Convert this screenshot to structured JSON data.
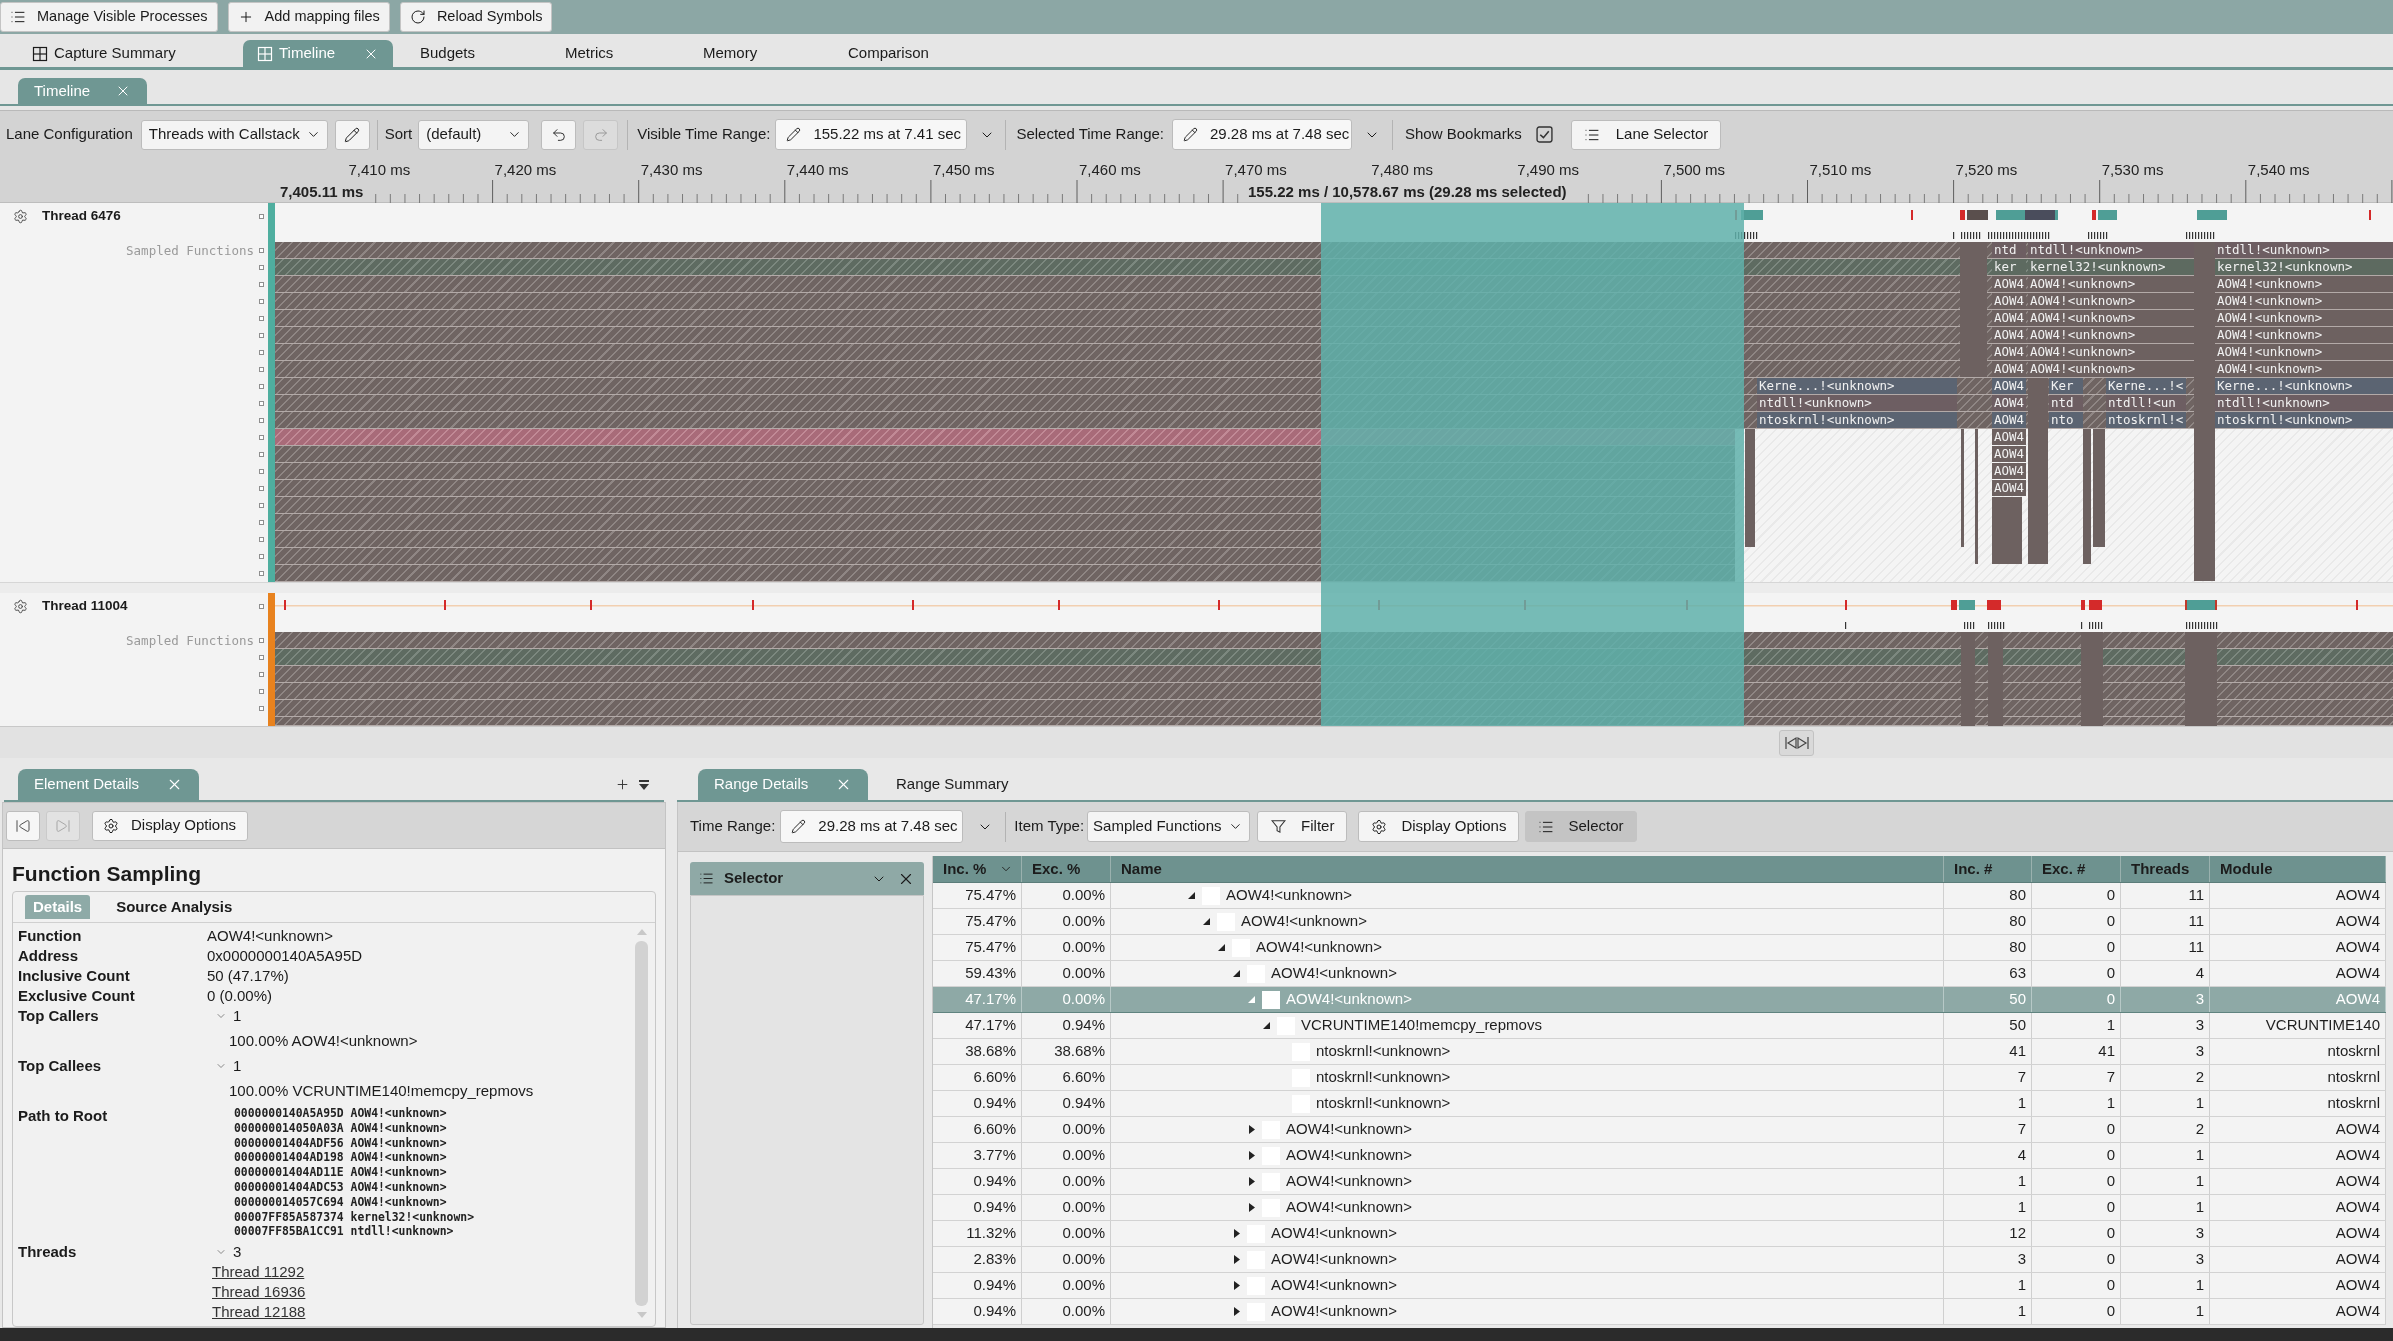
{
  "top_toolbar": {
    "buttons": [
      "Manage Visible Processes",
      "Add mapping files",
      "Reload Symbols"
    ]
  },
  "document_tabs": [
    {
      "label": "Capture Summary",
      "kind": "view",
      "selected": false
    },
    {
      "label": "Timeline",
      "kind": "view",
      "selected": true
    },
    {
      "label": "Budgets",
      "kind": "plain",
      "selected": false
    },
    {
      "label": "Metrics",
      "kind": "plain",
      "selected": false
    },
    {
      "label": "Memory",
      "kind": "plain",
      "selected": false
    },
    {
      "label": "Comparison",
      "kind": "plain",
      "selected": false
    }
  ],
  "view_tabs": [
    {
      "label": "Timeline",
      "selected": true
    }
  ],
  "lane_toolbar": {
    "lane_configuration": {
      "label": "Lane Configuration",
      "value": "Threads with Callstack"
    },
    "sort": {
      "label": "Sort",
      "value": "(default)"
    },
    "history": [
      {
        "kind": "undo",
        "disabled": false
      },
      {
        "kind": "redo",
        "disabled": true
      }
    ],
    "visible_time_range": {
      "label": "Visible Time Range:",
      "value": "155.22 ms at 7.41 sec"
    },
    "selected_time_range": {
      "label": "Selected Time Range:",
      "value": "29.28 ms at 7.48 sec"
    },
    "show_bookmarks": {
      "label": "Show Bookmarks",
      "checked": true
    },
    "lane_selector": {
      "label": "Lane Selector"
    }
  },
  "ruler": {
    "start": "7,405.11 ms",
    "summary": "155.22 ms / 10,578.67 ms (29.28 ms selected)",
    "ticks": [
      "7,410 ms",
      "7,420 ms",
      "7,430 ms",
      "7,440 ms",
      "7,450 ms",
      "7,460 ms",
      "7,470 ms",
      "7,480 ms",
      "7,490 ms",
      "7,500 ms",
      "7,510 ms",
      "7,520 ms",
      "7,530 ms",
      "7,540 ms"
    ]
  },
  "threads": [
    {
      "name": "Thread 6476",
      "color": "#4fae9f",
      "lane": "Sampled Functions",
      "stacks": [
        {
          "frames": [
            "Kerne...!<unknown>",
            "ntdll!<unknown>",
            "ntoskrnl!<unknown>"
          ]
        },
        {
          "frames": [
            "ntd",
            "ker",
            "AOW4",
            "AOW4",
            "AOW4",
            "AOW4",
            "AOW4",
            "AOW4",
            "AOW4",
            "AOW4",
            "AOW4",
            "AOW4",
            "AOW4",
            "AOW4",
            "AOW4"
          ]
        },
        {
          "frames": [
            "ntdll!<unknown>",
            "kernel32!<unknown>",
            "AOW4!<unknown>",
            "AOW4!<unknown>",
            "AOW4!<unknown>",
            "AOW4!<unknown>",
            "AOW4!<unknown>",
            "AOW4!<unknown>"
          ]
        },
        {
          "frames": [
            "Ker",
            "ntd",
            "nto"
          ]
        },
        {
          "frames": [
            "Kerne...!<",
            "ntdll!<un",
            "ntoskrnl!<"
          ]
        },
        {
          "frames": [
            "ntdll!<unknown>",
            "kernel32!<unknown>",
            "AOW4!<unknown>",
            "AOW4!<unknown>",
            "AOW4!<unknown>",
            "AOW4!<unknown>",
            "AOW4!<unknown>",
            "AOW4!<unknown>",
            "Kerne...!<unknown>",
            "ntdll!<unknown>",
            "ntoskrnl!<unknown>"
          ]
        }
      ]
    },
    {
      "name": "Thread 11004",
      "color": "#e8821e",
      "lane": "Sampled Functions"
    }
  ],
  "element_details": {
    "tabs": [
      {
        "label": "Element Details",
        "selected": true
      }
    ],
    "nav_buttons": [
      {
        "kind": "first",
        "disabled": false
      },
      {
        "kind": "last",
        "disabled": true
      }
    ],
    "display_options": "Display Options",
    "title": "Function Sampling",
    "detail_tabs": [
      {
        "label": "Details",
        "selected": true
      },
      {
        "label": "Source Analysis",
        "selected": false
      }
    ],
    "properties": [
      {
        "kind": "text",
        "label": "Function",
        "value": "AOW4!<unknown>"
      },
      {
        "kind": "text",
        "label": "Address",
        "value": "0x0000000140A5A95D"
      },
      {
        "kind": "text",
        "label": "Inclusive Count",
        "value": "50 (47.17%)"
      },
      {
        "kind": "text",
        "label": "Exclusive Count",
        "value": "0 (0.00%)"
      },
      {
        "kind": "group",
        "label": "Top Callers",
        "count": "1",
        "expanded": true,
        "items": [
          "100.00% AOW4!<unknown>"
        ]
      },
      {
        "kind": "group",
        "label": "Top Callees",
        "count": "1",
        "expanded": true,
        "items": [
          "100.00% VCRUNTIME140!memcpy_repmovs"
        ]
      },
      {
        "kind": "code",
        "label": "Path to Root",
        "lines": [
          "0000000140A5A95D AOW4!<unknown>",
          "000000014050A03A AOW4!<unknown>",
          "00000001404ADF56 AOW4!<unknown>",
          "00000001404AD198 AOW4!<unknown>",
          "00000001404AD11E AOW4!<unknown>",
          "00000001404ADC53 AOW4!<unknown>",
          "000000014057C694 AOW4!<unknown>",
          "00007FF85A587374 kernel32!<unknown>",
          "00007FF85BA1CC91 ntdll!<unknown>"
        ]
      },
      {
        "kind": "links",
        "label": "Threads",
        "count": "3",
        "expanded": true,
        "items": [
          "Thread 11292",
          "Thread 16936",
          "Thread 12188"
        ]
      }
    ]
  },
  "range_details": {
    "tabs": [
      {
        "label": "Range Details",
        "selected": true
      },
      {
        "label": "Range Summary",
        "selected": false
      }
    ],
    "time_range": {
      "label": "Time Range:",
      "value": "29.28 ms at 7.48 sec"
    },
    "item_type": {
      "label": "Item Type:",
      "value": "Sampled Functions"
    },
    "buttons": [
      {
        "kind": "filter",
        "label": "Filter",
        "pressed": false
      },
      {
        "kind": "settings",
        "label": "Display Options",
        "pressed": false
      },
      {
        "kind": "list",
        "label": "Selector",
        "pressed": true
      }
    ],
    "selector": {
      "title": "Selector"
    },
    "columns": [
      {
        "label": "Inc. %",
        "sorted": true
      },
      {
        "label": "Exc. %",
        "sorted": false
      },
      {
        "label": "Name",
        "sorted": false
      },
      {
        "label": "Inc. #",
        "sorted": false
      },
      {
        "label": "Exc. #",
        "sorted": false
      },
      {
        "label": "Threads",
        "sorted": false
      },
      {
        "label": "Module",
        "sorted": false
      }
    ],
    "rows": [
      {
        "inc_pct": "75.47%",
        "exc_pct": "0.00%",
        "name": "AOW4!<unknown>",
        "inc_count": "80",
        "exc_count": "0",
        "threads": "11",
        "module": "AOW4",
        "expanded": true,
        "selected": false,
        "children": [
          {
            "inc_pct": "75.47%",
            "exc_pct": "0.00%",
            "name": "AOW4!<unknown>",
            "inc_count": "80",
            "exc_count": "0",
            "threads": "11",
            "module": "AOW4",
            "expanded": true,
            "selected": false,
            "children": [
              {
                "inc_pct": "75.47%",
                "exc_pct": "0.00%",
                "name": "AOW4!<unknown>",
                "inc_count": "80",
                "exc_count": "0",
                "threads": "11",
                "module": "AOW4",
                "expanded": true,
                "selected": false,
                "children": [
                  {
                    "inc_pct": "59.43%",
                    "exc_pct": "0.00%",
                    "name": "AOW4!<unknown>",
                    "inc_count": "63",
                    "exc_count": "0",
                    "threads": "4",
                    "module": "AOW4",
                    "expanded": true,
                    "selected": false,
                    "children": [
                      {
                        "inc_pct": "47.17%",
                        "exc_pct": "0.00%",
                        "name": "AOW4!<unknown>",
                        "inc_count": "50",
                        "exc_count": "0",
                        "threads": "3",
                        "module": "AOW4",
                        "expanded": true,
                        "selected": true,
                        "children": [
                          {
                            "inc_pct": "47.17%",
                            "exc_pct": "0.94%",
                            "name": "VCRUNTIME140!memcpy_repmovs",
                            "inc_count": "50",
                            "exc_count": "1",
                            "threads": "3",
                            "module": "VCRUNTIME140",
                            "expanded": true,
                            "selected": false,
                            "children": [
                              {
                                "inc_pct": "38.68%",
                                "exc_pct": "38.68%",
                                "name": "ntoskrnl!<unknown>",
                                "inc_count": "41",
                                "exc_count": "41",
                                "threads": "3",
                                "module": "ntoskrnl",
                                "selected": false
                              },
                              {
                                "inc_pct": "6.60%",
                                "exc_pct": "6.60%",
                                "name": "ntoskrnl!<unknown>",
                                "inc_count": "7",
                                "exc_count": "7",
                                "threads": "2",
                                "module": "ntoskrnl",
                                "selected": false
                              },
                              {
                                "inc_pct": "0.94%",
                                "exc_pct": "0.94%",
                                "name": "ntoskrnl!<unknown>",
                                "inc_count": "1",
                                "exc_count": "1",
                                "threads": "1",
                                "module": "ntoskrnl",
                                "selected": false
                              }
                            ]
                          }
                        ]
                      },
                      {
                        "inc_pct": "6.60%",
                        "exc_pct": "0.00%",
                        "name": "AOW4!<unknown>",
                        "inc_count": "7",
                        "exc_count": "0",
                        "threads": "2",
                        "module": "AOW4",
                        "expanded": false,
                        "selected": false
                      },
                      {
                        "inc_pct": "3.77%",
                        "exc_pct": "0.00%",
                        "name": "AOW4!<unknown>",
                        "inc_count": "4",
                        "exc_count": "0",
                        "threads": "1",
                        "module": "AOW4",
                        "expanded": false,
                        "selected": false
                      },
                      {
                        "inc_pct": "0.94%",
                        "exc_pct": "0.00%",
                        "name": "AOW4!<unknown>",
                        "inc_count": "1",
                        "exc_count": "0",
                        "threads": "1",
                        "module": "AOW4",
                        "expanded": false,
                        "selected": false
                      },
                      {
                        "inc_pct": "0.94%",
                        "exc_pct": "0.00%",
                        "name": "AOW4!<unknown>",
                        "inc_count": "1",
                        "exc_count": "0",
                        "threads": "1",
                        "module": "AOW4",
                        "expanded": false,
                        "selected": false
                      }
                    ]
                  },
                  {
                    "inc_pct": "11.32%",
                    "exc_pct": "0.00%",
                    "name": "AOW4!<unknown>",
                    "inc_count": "12",
                    "exc_count": "0",
                    "threads": "3",
                    "module": "AOW4",
                    "expanded": false,
                    "selected": false
                  },
                  {
                    "inc_pct": "2.83%",
                    "exc_pct": "0.00%",
                    "name": "AOW4!<unknown>",
                    "inc_count": "3",
                    "exc_count": "0",
                    "threads": "3",
                    "module": "AOW4",
                    "expanded": false,
                    "selected": false
                  },
                  {
                    "inc_pct": "0.94%",
                    "exc_pct": "0.00%",
                    "name": "AOW4!<unknown>",
                    "inc_count": "1",
                    "exc_count": "0",
                    "threads": "1",
                    "module": "AOW4",
                    "expanded": false,
                    "selected": false
                  },
                  {
                    "inc_pct": "0.94%",
                    "exc_pct": "0.00%",
                    "name": "AOW4!<unknown>",
                    "inc_count": "1",
                    "exc_count": "0",
                    "threads": "1",
                    "module": "AOW4",
                    "expanded": false,
                    "selected": false
                  }
                ]
              }
            ]
          }
        ]
      }
    ]
  }
}
